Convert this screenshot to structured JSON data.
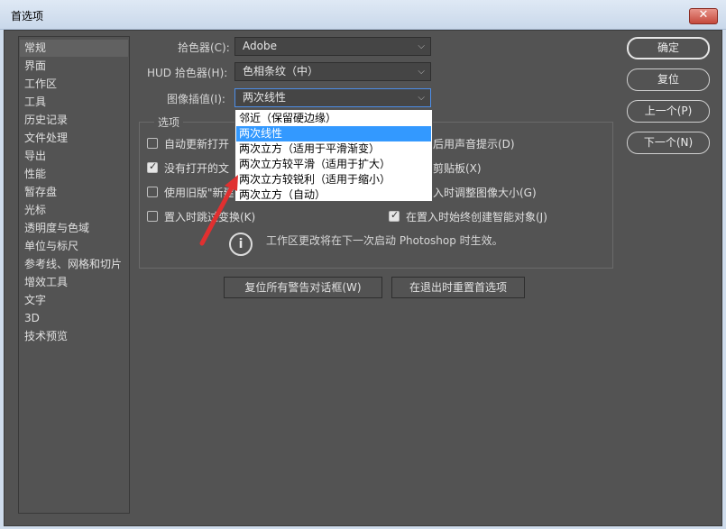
{
  "window": {
    "title": "首选项",
    "close_symbol": "✕"
  },
  "sidebar": {
    "items": [
      {
        "label": "常规",
        "selected": true
      },
      {
        "label": "界面"
      },
      {
        "label": "工作区"
      },
      {
        "label": "工具"
      },
      {
        "label": "历史记录"
      },
      {
        "label": "文件处理"
      },
      {
        "label": "导出"
      },
      {
        "label": "性能"
      },
      {
        "label": "暂存盘"
      },
      {
        "label": "光标"
      },
      {
        "label": "透明度与色域"
      },
      {
        "label": "单位与标尺"
      },
      {
        "label": "参考线、网格和切片"
      },
      {
        "label": "增效工具"
      },
      {
        "label": "文字"
      },
      {
        "label": "3D"
      },
      {
        "label": "技术预览"
      }
    ]
  },
  "form": {
    "color_picker": {
      "label": "拾色器(C):",
      "value": "Adobe"
    },
    "hud_color_picker": {
      "label": "HUD 拾色器(H):",
      "value": "色相条纹（中）"
    },
    "image_interpolation": {
      "label": "图像插值(I):",
      "value": "两次线性"
    }
  },
  "options": {
    "group_label": "选项",
    "left": [
      {
        "label": "自动更新打开",
        "checked": false
      },
      {
        "label": "没有打开的文",
        "checked": true
      },
      {
        "label": "使用旧版\"新建",
        "checked": false
      },
      {
        "label": "置入时跳过变换(K)",
        "checked": false
      }
    ],
    "right": [
      {
        "label": "后用声音提示(D)",
        "checked": null
      },
      {
        "label": "剪贴板(X)",
        "checked": null
      },
      {
        "label": "入时调整图像大小(G)",
        "checked": null
      },
      {
        "label": "在置入时始终创建智能对象(J)",
        "checked": true
      }
    ],
    "info_icon": "i",
    "info_text": "工作区更改将在下一次启动 Photoshop 时生效。"
  },
  "bottom_buttons": {
    "reset_warnings": "复位所有警告对话框(W)",
    "reset_on_quit": "在退出时重置首选项"
  },
  "right_buttons": {
    "ok": "确定",
    "reset": "复位",
    "prev": "上一个(P)",
    "next": "下一个(N)"
  },
  "dropdown": {
    "items": [
      {
        "label": "邻近（保留硬边缘）"
      },
      {
        "label": "两次线性",
        "highlighted": true
      },
      {
        "label": "两次立方（适用于平滑渐变）"
      },
      {
        "label": "两次立方较平滑（适用于扩大）"
      },
      {
        "label": "两次立方较锐利（适用于缩小）"
      },
      {
        "label": "两次立方（自动）"
      }
    ]
  },
  "colors": {
    "panel_bg": "#535353",
    "highlight": "#3399ff",
    "annotation_arrow": "#e03030"
  }
}
